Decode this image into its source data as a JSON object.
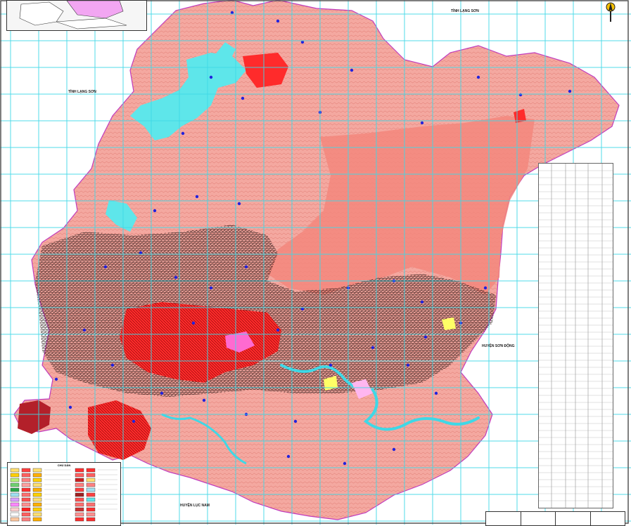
{
  "map": {
    "labels": {
      "tinh_lang_son_ne": "TỈNH LẠNG SƠN",
      "tinh_lang_son_w": "TỈNH LẠNG SƠN",
      "huyen_son_dong": "HUYỆN SƠN ĐỘNG",
      "huyen_luc_nam": "HUYỆN LỤC NAM"
    },
    "legend": {
      "title": "CHÚ DẪN"
    },
    "colors": {
      "land_base": "#f4a8a0",
      "forest_dark": "#f08078",
      "water": "#5ee6ea",
      "urban": "#ff2020",
      "points": "#2222dd",
      "grid": "#3fd8e6",
      "border": "#c03cc0"
    }
  }
}
